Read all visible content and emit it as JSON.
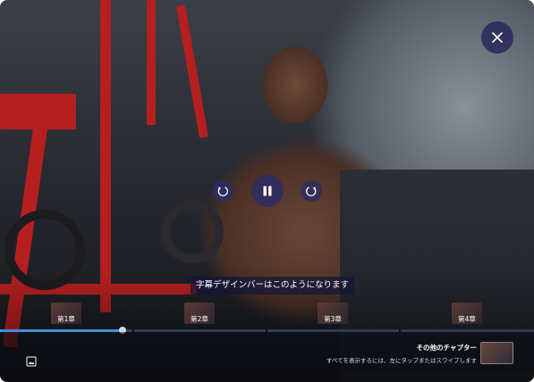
{
  "player": {
    "subtitle": "字幕デザインバーはこのようになります",
    "progress": 0.23,
    "chapters": [
      {
        "label": "第1章"
      },
      {
        "label": "第2章"
      },
      {
        "label": "第3章"
      },
      {
        "label": "第4章"
      }
    ],
    "other_chapters": {
      "title": "その他のチャプター",
      "hint": "すべてを表示するには、左にタップまたはスワイプします"
    }
  },
  "icons": {
    "close": "close-icon",
    "rewind": "rewind-icon",
    "pause": "pause-icon",
    "forward": "forward-icon",
    "image": "image-icon"
  },
  "colors": {
    "accent": "#3f8de0",
    "button_bg": "#2d2d64"
  }
}
